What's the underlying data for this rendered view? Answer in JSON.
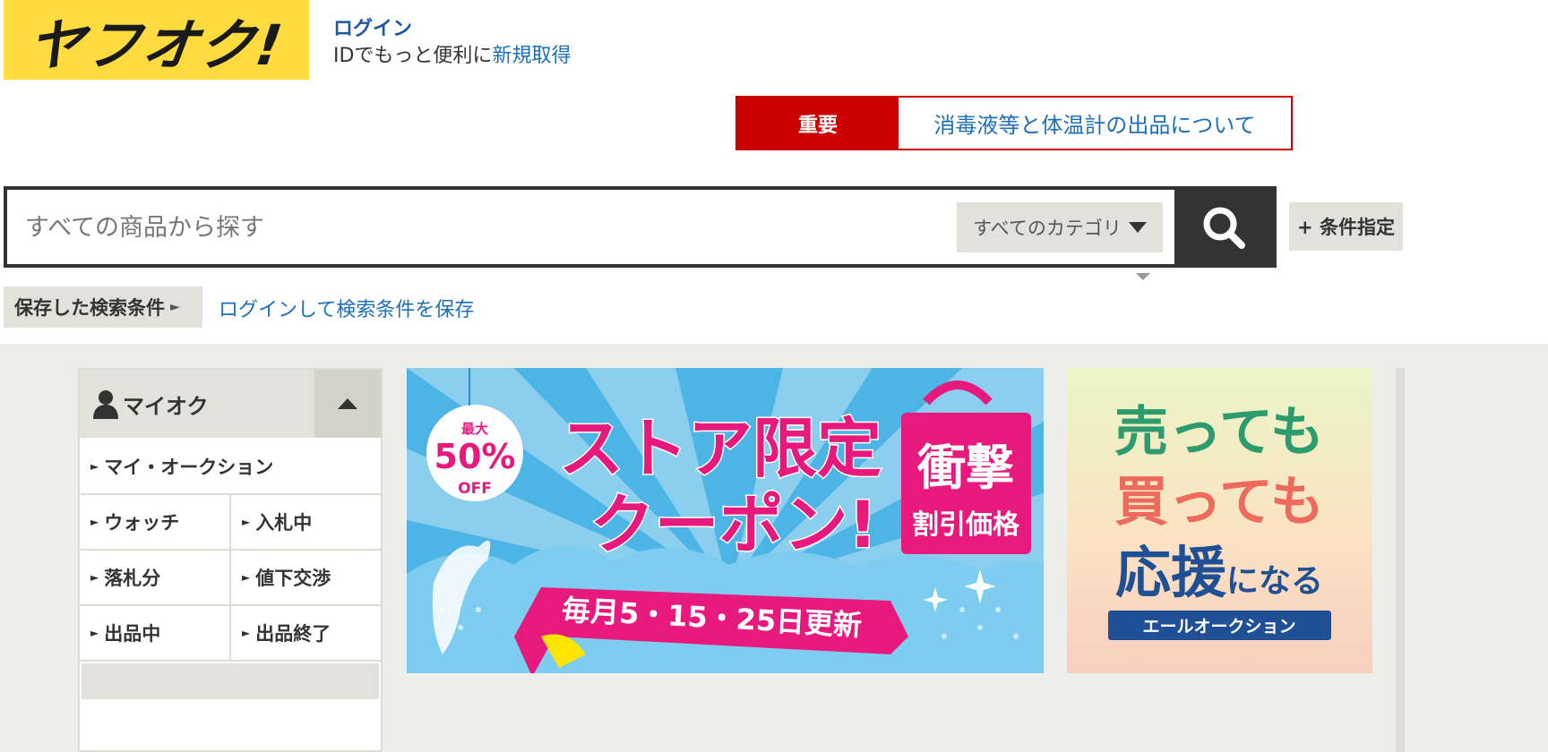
{
  "header": {
    "logo_text": "ヤフオク!",
    "login_label": "ログイン",
    "login_sub_text": "IDでもっと便利に",
    "register_label": "新規取得"
  },
  "notice": {
    "label": "重要",
    "text": "消毒液等と体温計の出品について"
  },
  "search": {
    "placeholder": "すべての商品から探す",
    "category_label": "すべてのカテゴリ",
    "advanced_label": "+ 条件指定"
  },
  "saved_search": {
    "label": "保存した検索条件",
    "link": "ログインして検索条件を保存"
  },
  "myauction": {
    "title": "マイオク",
    "items": [
      "マイ・オークション",
      "ウォッチ",
      "入札中",
      "落札分",
      "値下交渉",
      "出品中",
      "出品終了"
    ]
  },
  "banner_store": {
    "badge_top": "最大",
    "badge_percent": "50%",
    "badge_off": "OFF",
    "headline1": "ストア限定",
    "headline2": "クーポン!",
    "bag_line1": "衝撃",
    "bag_line2": "割引価格",
    "ribbon": "毎月5・15・25日更新"
  },
  "banner_yell": {
    "line1": "売っても",
    "line2": "買っても",
    "line3_big": "応援",
    "line3_small": "になる",
    "tag": "エールオークション"
  },
  "colors": {
    "logo_yellow": "#ffdb3f",
    "notice_red": "#cc0000",
    "link_blue": "#1d6fb8",
    "banner_pink": "#e8197d",
    "banner_sky": "#4db4e6"
  }
}
